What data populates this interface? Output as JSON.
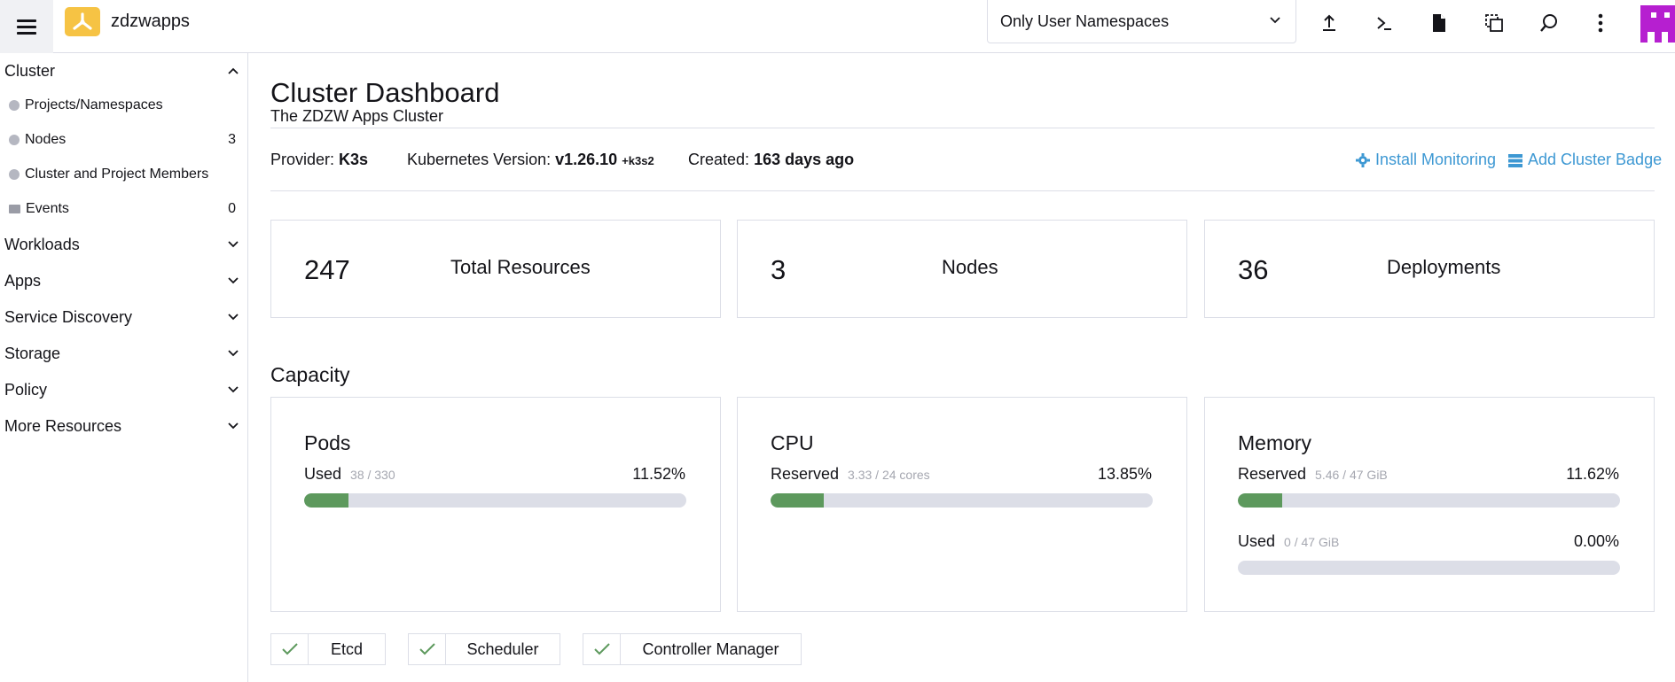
{
  "header": {
    "cluster_name": "zdzwapps",
    "namespace_filter": "Only User Namespaces",
    "icons": [
      "upload-icon",
      "terminal-icon",
      "file-icon",
      "copy-config-icon",
      "search-icon",
      "more-vert-icon"
    ]
  },
  "sidebar": {
    "cluster_label": "Cluster",
    "cluster_items": [
      {
        "label": "Projects/Namespaces",
        "count": ""
      },
      {
        "label": "Nodes",
        "count": "3"
      },
      {
        "label": "Cluster and Project Members",
        "count": ""
      },
      {
        "label": "Events",
        "count": "0"
      }
    ],
    "groups": [
      "Workloads",
      "Apps",
      "Service Discovery",
      "Storage",
      "Policy",
      "More Resources"
    ]
  },
  "main": {
    "title": "Cluster Dashboard",
    "subtitle": "The ZDZW Apps Cluster",
    "provider_label": "Provider:",
    "provider_value": "K3s",
    "k8s_label": "Kubernetes Version:",
    "k8s_value": "v1.26.10",
    "k8s_suffix": "+k3s2",
    "created_label": "Created:",
    "created_value": "163 days ago",
    "install_monitoring": "Install Monitoring",
    "add_badge": "Add Cluster Badge",
    "stats": [
      {
        "value": "247",
        "label": "Total Resources"
      },
      {
        "value": "3",
        "label": "Nodes"
      },
      {
        "value": "36",
        "label": "Deployments"
      }
    ],
    "capacity_title": "Capacity",
    "capacity": {
      "pods": {
        "title": "Pods",
        "label": "Used",
        "detail": "38 / 330",
        "pct": "11.52%",
        "fraction": 0.1152
      },
      "cpu": {
        "title": "CPU",
        "label": "Reserved",
        "detail": "3.33 / 24 cores",
        "pct": "13.85%",
        "fraction": 0.1385
      },
      "memory": {
        "title": "Memory",
        "reserved": {
          "label": "Reserved",
          "detail": "5.46 / 47 GiB",
          "pct": "11.62%",
          "fraction": 0.1162
        },
        "used": {
          "label": "Used",
          "detail": "0 / 47 GiB",
          "pct": "0.00%",
          "fraction": 0
        }
      }
    },
    "health": [
      "Etcd",
      "Scheduler",
      "Controller Manager"
    ]
  },
  "colors": {
    "accent": "#3d98d3",
    "bar_fill": "#5d995d",
    "bar_track": "#dcdee7",
    "logo": "#f6c344",
    "avatar": "#b61fd0",
    "check": "#5d995d"
  }
}
